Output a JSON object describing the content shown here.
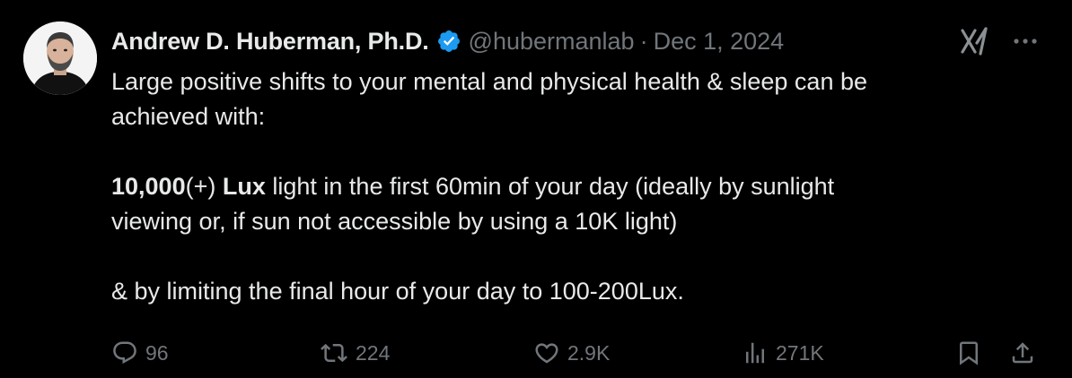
{
  "author": {
    "name": "Andrew D. Huberman, Ph.D.",
    "handle": "@hubermanlab",
    "separator": "·",
    "date": "Dec 1, 2024",
    "avatar_icon": "portrait-avatar-icon",
    "verified_icon": "verified-badge-icon"
  },
  "tweet": {
    "line1": "Large positive shifts to your mental and physical health & sleep can be",
    "line2": "achieved with:",
    "bold1": "10,000",
    "mid1": "(+) ",
    "bold2": "Lux",
    "line3_rest": " light in the first 60min of your day (ideally by sunlight",
    "line4": "viewing or, if sun not accessible by using a 10K light)",
    "line5": "& by limiting the final hour of your day to 100-200Lux."
  },
  "actions": {
    "replies": "96",
    "reposts": "224",
    "likes": "2.9K",
    "views": "271K"
  },
  "icons": {
    "grok": "grok-icon",
    "more": "more-options-icon",
    "reply": "reply-icon",
    "repost": "repost-icon",
    "like": "heart-icon",
    "views": "views-chart-icon",
    "bookmark": "bookmark-icon",
    "share": "share-icon"
  },
  "colors": {
    "background": "#000000",
    "text": "#e7e9ea",
    "muted": "#71767b",
    "verified": "#1d9bf0"
  }
}
